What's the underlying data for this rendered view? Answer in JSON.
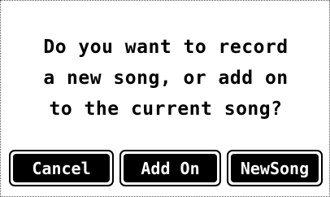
{
  "dialog": {
    "message_lines": [
      "Do you want to record",
      "a new song, or add on",
      "to the current song?"
    ],
    "buttons": {
      "cancel": "Cancel",
      "add_on": "Add On",
      "new_song": "NewSong"
    }
  },
  "colors": {
    "background": "#ffffff",
    "text": "#000000",
    "button_fill": "#000000",
    "button_text": "#ffffff"
  }
}
